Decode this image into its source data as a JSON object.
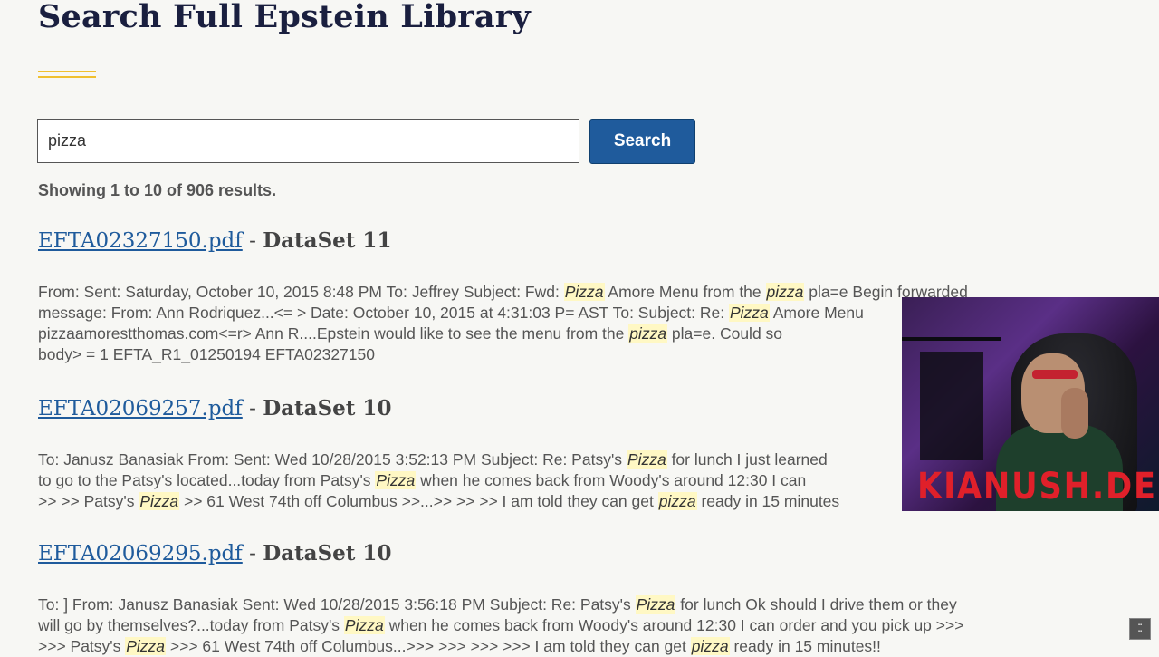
{
  "page": {
    "title": "Search Full Epstein Library"
  },
  "search": {
    "value": "pizza",
    "button_label": "Search"
  },
  "summary": "Showing 1 to 10 of 906 results.",
  "results": [
    {
      "filename": "EFTA02327150.pdf",
      "separator": " - ",
      "dataset": "DataSet 11",
      "lines": [
        [
          "From: Sent: Saturday, October 10, 2015 8:48 PM To: Jeffrey Subject: Fwd: ",
          "Pizza",
          " Amore Menu from the ",
          "pizza",
          " pla=e Begin forwarded"
        ],
        [
          "message: From: Ann Rodriquez...<= > Date: October 10, 2015 at 4:31:03 P= AST To: Subject: Re: ",
          "Pizza",
          " Amore Menu"
        ],
        [
          "pizzaamorestthomas.com<=r> Ann R....Epstein would like to see the menu from the ",
          "pizza",
          " pla=e. Could so"
        ],
        [
          "body> = 1 EFTA_R1_01250194 EFTA02327150"
        ]
      ]
    },
    {
      "filename": "EFTA02069257.pdf",
      "separator": " - ",
      "dataset": "DataSet 10",
      "lines": [
        [
          "To: Janusz Banasiak From: Sent: Wed 10/28/2015 3:52:13 PM Subject: Re: Patsy's ",
          "Pizza",
          " for lunch I just learned"
        ],
        [
          "to go to the Patsy's located...today from Patsy's ",
          "Pizza",
          " when he comes back from Woody's around 12:30 I can"
        ],
        [
          ">> >> Patsy's ",
          "Pizza",
          " >> 61 West 74th off Columbus >>...>> >> >> I am told they can get ",
          "pizza",
          " ready in 15 minutes"
        ]
      ]
    },
    {
      "filename": "EFTA02069295.pdf",
      "separator": " - ",
      "dataset": "DataSet 10",
      "lines": [
        [
          "To: ] From: Janusz Banasiak Sent: Wed 10/28/2015 3:56:18 PM Subject: Re: Patsy's ",
          "Pizza",
          " for lunch Ok should I drive them or they"
        ],
        [
          "will go by themselves?...today from Patsy's ",
          "Pizza",
          " when he comes back from Woody's around 12:30 I can order and you pick up >>>"
        ],
        [
          ">>> Patsy's ",
          "Pizza",
          " >>> 61 West 74th off Columbus...>>> >>> >>> >>> I am told they can get ",
          "pizza",
          " ready in 15 minutes!!"
        ]
      ]
    }
  ],
  "overlay": {
    "brand": "KIANUSH.DE"
  },
  "colors": {
    "link": "#1f5b9c",
    "title": "#1a1f3f",
    "accent": "#f0c030",
    "highlight": "#fff8c4",
    "brand": "#e0202a"
  }
}
